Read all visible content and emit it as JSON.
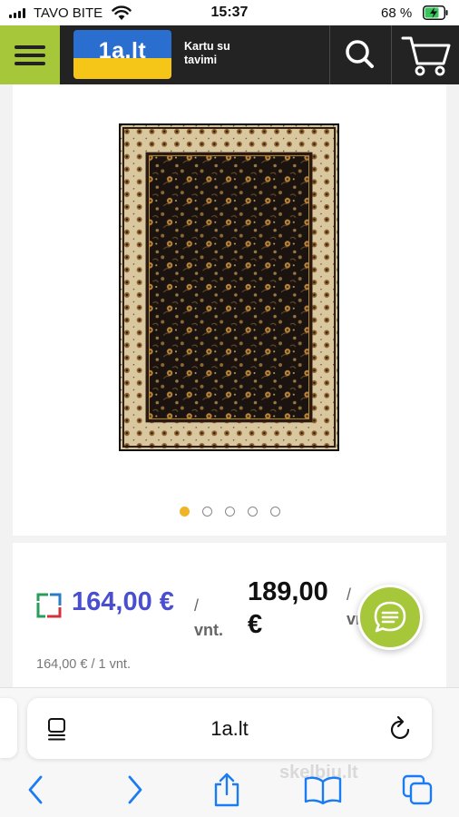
{
  "status_bar": {
    "carrier": "TAVO BITE",
    "time": "15:37",
    "battery": "68 %"
  },
  "header": {
    "logo_text": "1a.lt",
    "slogan_line1": "Kartu su",
    "slogan_line2": "tavimi"
  },
  "gallery": {
    "image_count": 5,
    "active_index": 0
  },
  "price": {
    "current": "164,00 €",
    "current_unit_slash": "/",
    "current_unit": "vnt.",
    "old_line1": "189,00",
    "old_line2": "€",
    "old_unit_slash": "/",
    "old_unit": "vnt.",
    "per_unit": "164,00 € / 1 vnt."
  },
  "browser": {
    "url": "1a.lt",
    "watermark": "skelbiu.lt"
  },
  "colors": {
    "brand_green": "#a6c73a",
    "price_blue": "#4a4fd0",
    "safari_blue": "#1a7cf5"
  }
}
